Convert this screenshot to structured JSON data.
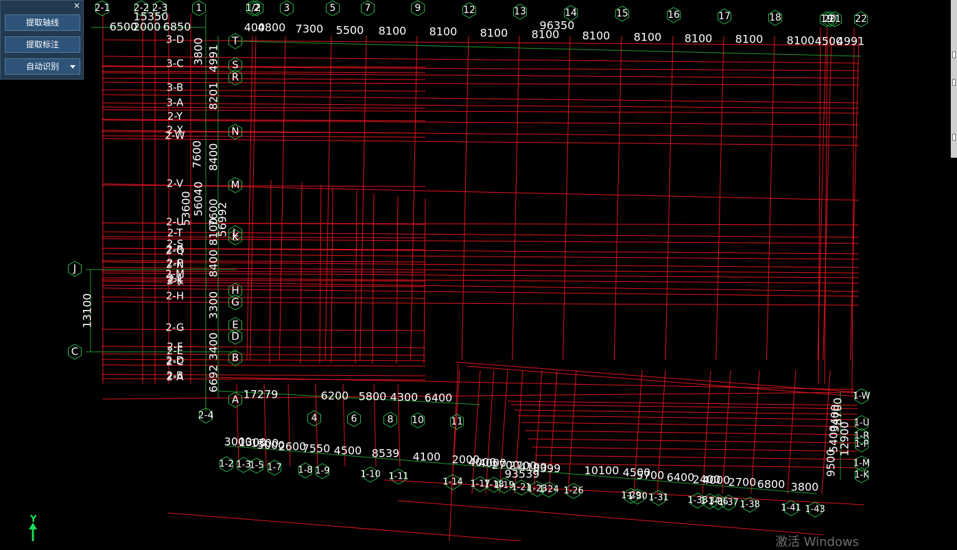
{
  "toolbar": {
    "close_glyph": "×",
    "extract_axis": "提取轴线",
    "extract_dims": "提取标注",
    "auto_recognize": "自动识别",
    "dropdown_icon": "caret-down-icon"
  },
  "ucs": {
    "label": "Y",
    "color": "#19e05a"
  },
  "watermark": "激活 Windows",
  "colors": {
    "background": "#000000",
    "grid_red": "#e0141e",
    "axis_green": "#1f9a2e",
    "text": "#ffffff",
    "bubble": "#2ab64a"
  },
  "top_bubbles": [
    "2-1",
    "2-2",
    "2-3",
    "1",
    "1/2",
    "2",
    "3",
    "5",
    "7",
    "9",
    "12",
    "13",
    "14",
    "15",
    "16",
    "17",
    "18",
    "19",
    "20",
    "21",
    "22"
  ],
  "top_dims": [
    "6500",
    "2000",
    "6850",
    "15350",
    "400",
    "4800",
    "7300",
    "5500",
    "8100",
    "8100",
    "8100",
    "8100",
    "96350",
    "8100",
    "8100",
    "8100",
    "8100",
    "8100",
    "4500",
    "4991"
  ],
  "left_rows": [
    "3-D",
    "3-C",
    "3-B",
    "3-A",
    "2-Y",
    "2-X",
    "2-W",
    "2-V",
    "2-U",
    "2-T",
    "2-S",
    "2-R",
    "2-Q",
    "2-P",
    "2-N",
    "2-M",
    "2-L",
    "2-K",
    "2-J",
    "2-H",
    "2-G",
    "2-F",
    "2-E",
    "2-D",
    "2-C",
    "2-B",
    "2-A"
  ],
  "main_rows": [
    "T",
    "S",
    "R",
    "N",
    "M",
    "L",
    "K",
    "H",
    "G",
    "E",
    "D",
    "B",
    "A",
    "J",
    "C"
  ],
  "vertical_dims": [
    "3800",
    "4991",
    "8201",
    "7600",
    "8400",
    "53600",
    "56040",
    "7600",
    "56992",
    "8100",
    "8400",
    "3300",
    "6692",
    "3400",
    "13100"
  ],
  "lower_cols": [
    "2-4",
    "4",
    "6",
    "8",
    "10",
    "11"
  ],
  "lower_dims": [
    "17279",
    "6200",
    "5800",
    "4300",
    "6400"
  ],
  "bottom_row_dims": [
    "3000",
    "1300",
    "1300",
    "5000",
    "2600",
    "7550",
    "4500",
    "8539",
    "4100",
    "2000",
    "4000",
    "4000",
    "2700",
    "2700",
    "4100",
    "3399",
    "93539",
    "10100",
    "4500",
    "5700",
    "6400",
    "2400",
    "4000",
    "2700",
    "6800",
    "3800"
  ],
  "bottom_bubbles": [
    "1-2",
    "1-3",
    "1-5",
    "1-7",
    "1-8",
    "1-9",
    "1-10",
    "1-11",
    "1-14",
    "1-17",
    "1-18",
    "1-19",
    "1-21",
    "1-23",
    "1-24",
    "1-26",
    "1-29",
    "1-30",
    "1-31",
    "1-33",
    "1-34",
    "1-36",
    "1-37",
    "1-38",
    "1-41",
    "1-43"
  ],
  "right_bubbles": [
    "1-W",
    "1-U",
    "1-R",
    "1-P",
    "1-M",
    "1-K"
  ],
  "right_dims": [
    "9500",
    "5400",
    "8700",
    "3400",
    "12900"
  ]
}
